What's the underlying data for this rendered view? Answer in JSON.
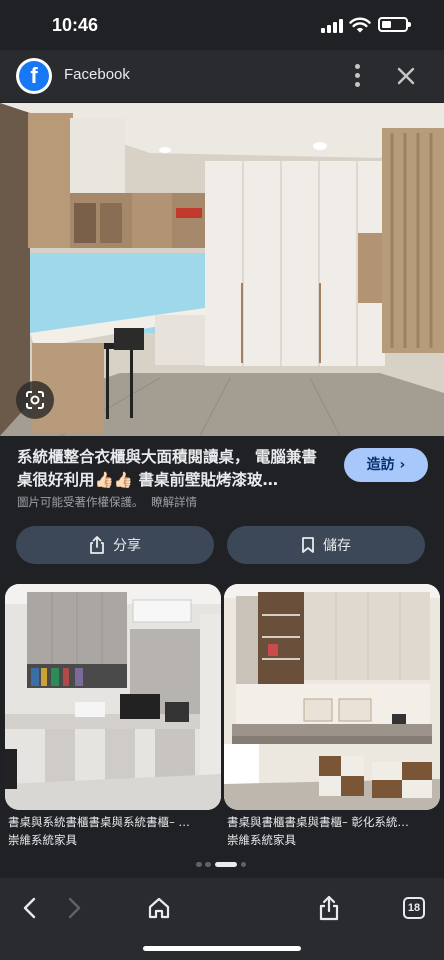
{
  "status_bar": {
    "time": "10:46"
  },
  "top_bar": {
    "site_name": "Facebook",
    "logo_letter": "f",
    "brand_color": "#1877f2"
  },
  "result": {
    "title": "系統櫃整合衣櫃與大面積閱讀桌， 電腦兼書桌很好利用👍🏻👍🏻 書桌前壁貼烤漆玻…",
    "visit_label": "造訪",
    "copyright_text": "圖片可能受著作權保護。",
    "learn_more": "瞭解詳情",
    "accent_color": "#a8c7fa"
  },
  "actions": {
    "share_label": "分享",
    "save_label": "儲存"
  },
  "related": [
    {
      "title": "書桌與系統書櫃書桌與系統書櫃– …",
      "source": "崇維系統家具"
    },
    {
      "title": "書桌與書櫃書桌與書櫃– 彰化系統…",
      "source": "崇維系統家具"
    }
  ],
  "bottom_bar": {
    "tab_count": "18"
  }
}
